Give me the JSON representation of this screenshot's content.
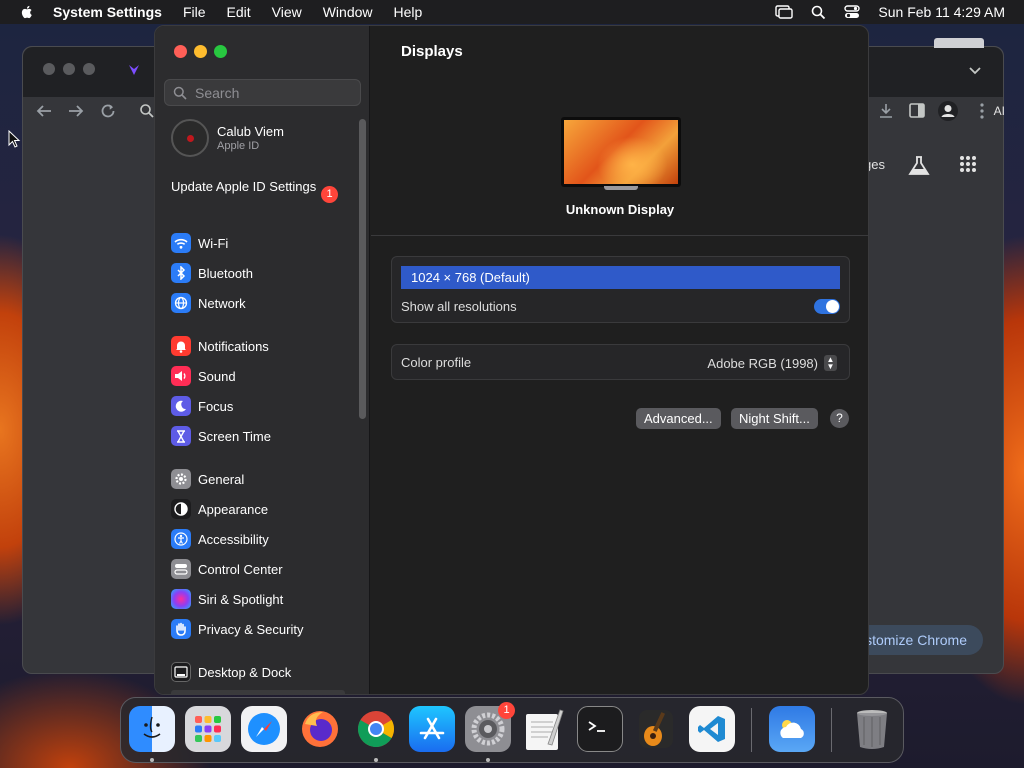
{
  "menubar": {
    "app_name": "System Settings",
    "menus": [
      "File",
      "Edit",
      "View",
      "Window",
      "Help"
    ],
    "datetime": "Sun Feb 11  4:29 AM"
  },
  "chrome": {
    "partial_label": "ges",
    "customize_label": "ustomize Chrome",
    "ai_label": "AI"
  },
  "sidebar": {
    "search_placeholder": "Search",
    "profile": {
      "name": "Calub Viem",
      "subtitle": "Apple ID"
    },
    "update": {
      "label": "Update Apple ID Settings",
      "badge": "1"
    },
    "items": [
      {
        "label": "Wi-Fi",
        "color": "#2b7cf7",
        "icon": "wifi-icon"
      },
      {
        "label": "Bluetooth",
        "color": "#2b7cf7",
        "icon": "bluetooth-icon"
      },
      {
        "label": "Network",
        "color": "#2b7cf7",
        "icon": "globe-icon"
      },
      {
        "label": "Notifications",
        "color": "#ff3b30",
        "icon": "bell-icon"
      },
      {
        "label": "Sound",
        "color": "#ff2d55",
        "icon": "speaker-icon"
      },
      {
        "label": "Focus",
        "color": "#5e5ce6",
        "icon": "moon-icon"
      },
      {
        "label": "Screen Time",
        "color": "#5e5ce6",
        "icon": "hourglass-icon"
      },
      {
        "label": "General",
        "color": "#8e8e93",
        "icon": "gear-icon"
      },
      {
        "label": "Appearance",
        "color": "#1c1c1e",
        "icon": "appearance-icon"
      },
      {
        "label": "Accessibility",
        "color": "#2b7cf7",
        "icon": "accessibility-icon"
      },
      {
        "label": "Control Center",
        "color": "#8e8e93",
        "icon": "control-center-icon"
      },
      {
        "label": "Siri & Spotlight",
        "color": "#8b3ff5",
        "icon": "siri-icon"
      },
      {
        "label": "Privacy & Security",
        "color": "#2b7cf7",
        "icon": "hand-icon"
      },
      {
        "label": "Desktop & Dock",
        "color": "#1c1c1e",
        "icon": "dock-icon"
      }
    ]
  },
  "displays": {
    "title": "Displays",
    "display_name": "Unknown Display",
    "resolution": "1024 × 768 (Default)",
    "show_all_label": "Show all resolutions",
    "show_all_on": true,
    "color_profile_label": "Color profile",
    "color_profile_value": "Adobe RGB (1998)",
    "advanced_label": "Advanced...",
    "night_shift_label": "Night Shift...",
    "help_label": "?"
  },
  "dock": {
    "settings_badge": "1"
  }
}
